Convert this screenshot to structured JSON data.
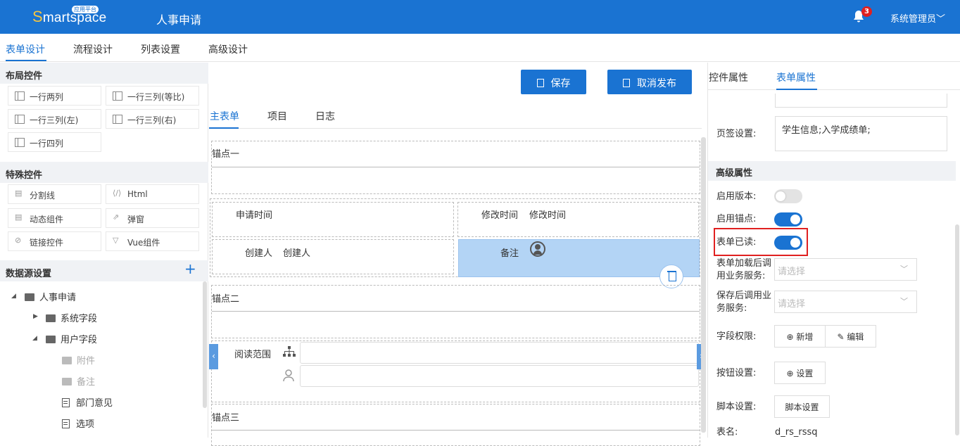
{
  "header": {
    "logo_text": "martspace",
    "logo_initial": "S",
    "logo_badge": "应用平台",
    "title": "人事申请",
    "notification_count": "3",
    "user": "系统管理员"
  },
  "main_tabs": [
    "表单设计",
    "流程设计",
    "列表设置",
    "高级设计"
  ],
  "left": {
    "layout_section": "布局控件",
    "layout_controls": [
      "一行两列",
      "一行三列(等比)",
      "一行三列(左)",
      "一行三列(右)",
      "一行四列"
    ],
    "special_section": "特殊控件",
    "special_controls": [
      "分割线",
      "Html",
      "动态组件",
      "弹窗",
      "链接控件",
      "Vue组件"
    ],
    "datasource_section": "数据源设置",
    "tree": {
      "root": "人事申请",
      "system_fields": "系统字段",
      "user_fields": "用户字段",
      "items": [
        "附件",
        "备注",
        "部门意见",
        "选项"
      ]
    }
  },
  "center": {
    "save_label": "保存",
    "unpublish_label": "取消发布",
    "tabs": [
      "主表单",
      "项目",
      "日志"
    ],
    "anchor1": "锚点一",
    "anchor2": "锚点二",
    "anchor3": "锚点三",
    "apply_time": "申请时间",
    "modify_time_label": "修改时间",
    "modify_time_value": "修改时间",
    "creator_label": "创建人",
    "creator_value": "创建人",
    "remark": "备注",
    "read_scope": "阅读范围"
  },
  "right": {
    "tabs": [
      "控件属性",
      "表单属性"
    ],
    "page_tabs_label": "页签设置:",
    "page_tabs_value": "学生信息;入学成绩单;",
    "advanced_section": "高级属性",
    "enable_version_label": "启用版本:",
    "enable_version": false,
    "enable_anchor_label": "启用锚点:",
    "enable_anchor": true,
    "form_read_label": "表单已读:",
    "form_read": true,
    "after_load_label": "表单加载后调用业务服务:",
    "after_load_placeholder": "请选择",
    "after_save_label": "保存后调用业务服务:",
    "after_save_placeholder": "请选择",
    "field_perm_label": "字段权限:",
    "add_label": "新增",
    "edit_label": "编辑",
    "button_settings_label": "按钮设置:",
    "settings_label": "设置",
    "script_settings_label": "脚本设置:",
    "script_button": "脚本设置",
    "table_name_label": "表名:",
    "table_name_value": "d_rs_rssq"
  },
  "colors": {
    "brand": "#1a73d2",
    "highlight": "#e02020",
    "selected": "#b3d4f5"
  }
}
